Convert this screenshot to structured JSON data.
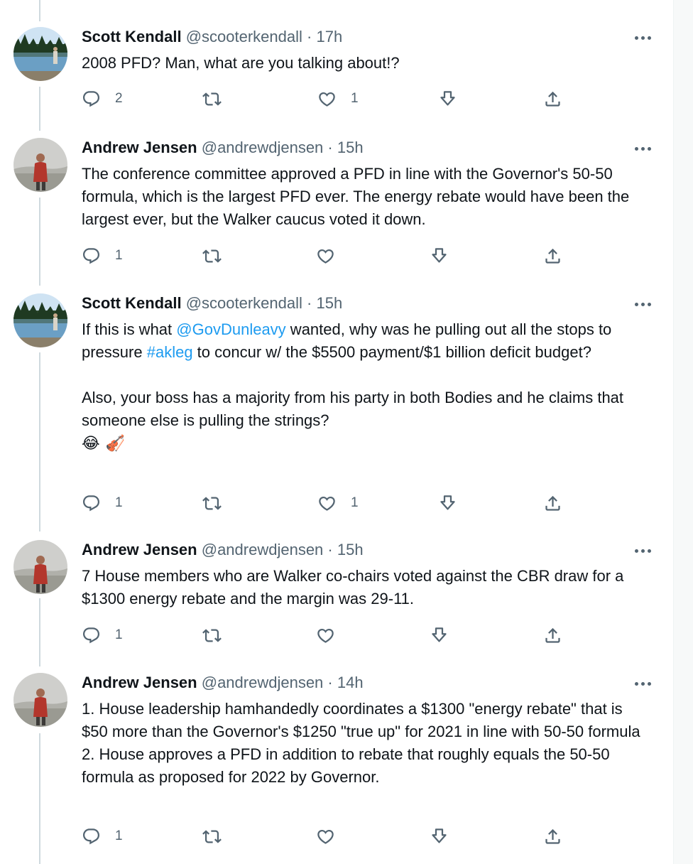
{
  "tweets": [
    {
      "name": "Scott Kendall",
      "handle": "@scooterkendall",
      "separator": "·",
      "time": "17h",
      "text": "2008 PFD? Man, what are you talking about!?",
      "reply_count": "2",
      "retweet_count": "",
      "like_count": "1"
    },
    {
      "name": "Andrew Jensen",
      "handle": "@andrewdjensen",
      "separator": "·",
      "time": "15h",
      "text": "The conference committee approved a PFD in line with the Governor's 50-50 formula, which is the largest PFD ever. The energy rebate would have been the largest ever, but the Walker caucus voted it down.",
      "reply_count": "1",
      "retweet_count": "",
      "like_count": ""
    },
    {
      "name": "Scott Kendall",
      "handle": "@scooterkendall",
      "separator": "·",
      "time": "15h",
      "text_parts": {
        "p1_a": "If this is what ",
        "mention": "@GovDunleavy",
        "p1_b": " wanted, why was he pulling out all the stops to pressure ",
        "hashtag": "#akleg",
        "p1_c": " to concur w/ the $5500 payment/$1 billion deficit budget?",
        "p2": "Also, your boss has a majority from his party in both Bodies and he claims that someone else is pulling the strings?",
        "emoji": [
          "😂",
          "🎻"
        ]
      },
      "reply_count": "1",
      "retweet_count": "",
      "like_count": "1"
    },
    {
      "name": "Andrew Jensen",
      "handle": "@andrewdjensen",
      "separator": "·",
      "time": "15h",
      "text": "7 House members who are Walker co-chairs voted against the CBR draw for a $1300 energy rebate and the margin was 29-11.",
      "reply_count": "1",
      "retweet_count": "",
      "like_count": ""
    },
    {
      "name": "Andrew Jensen",
      "handle": "@andrewdjensen",
      "separator": "·",
      "time": "14h",
      "lines": [
        "1. House leadership hamhandedly coordinates a $1300 \"energy rebate\" that is $50 more than the Governor's $1250 \"true up\" for 2021 in line with 50-50 formula",
        "2. House approves a PFD in addition to rebate that roughly equals the 50-50 formula as proposed for 2022 by Governor."
      ],
      "reply_count": "1",
      "retweet_count": "",
      "like_count": ""
    }
  ],
  "icons": {
    "reply": "reply-icon",
    "retweet": "retweet-icon",
    "like": "heart-icon",
    "bookmark": "download-icon",
    "share": "share-icon",
    "more": "more-icon"
  },
  "colors": {
    "text": "#0f1419",
    "secondary": "#536471",
    "link": "#1d9bf0",
    "thread_line": "#cfd9de"
  }
}
